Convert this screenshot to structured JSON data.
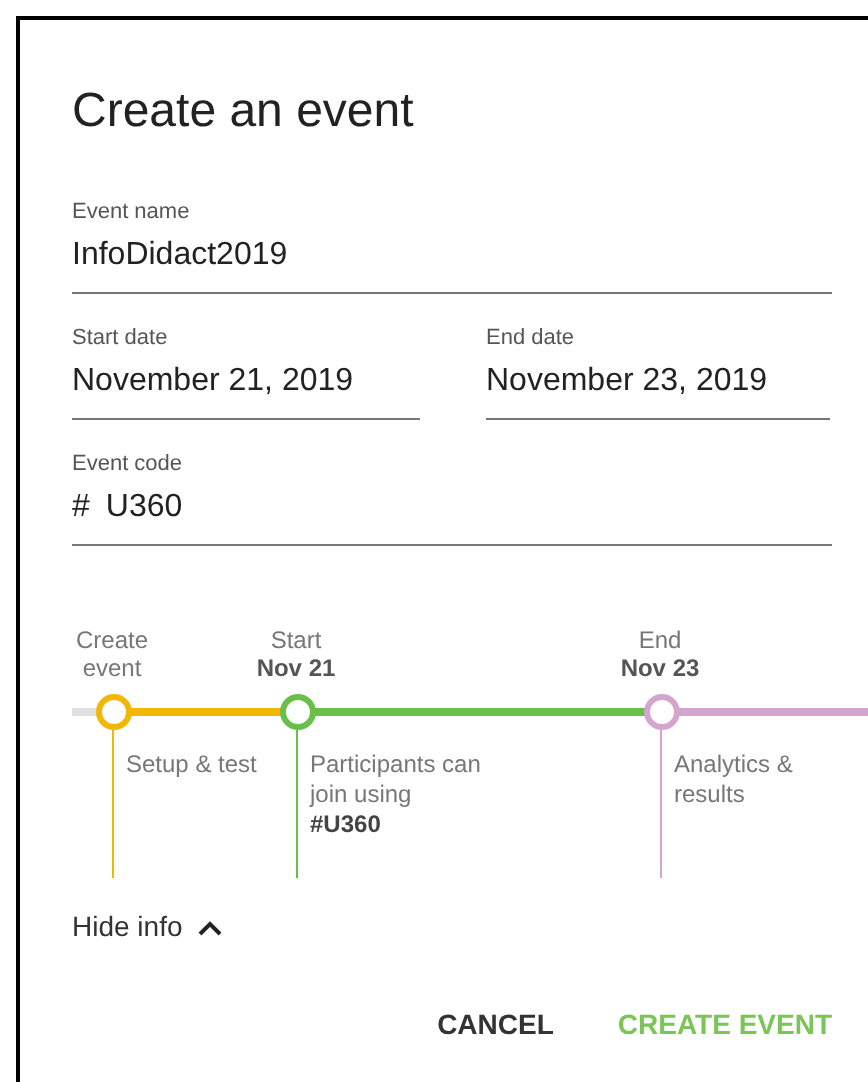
{
  "dialog": {
    "title": "Create an event",
    "fields": [
      {
        "label": "Event name",
        "value": "InfoDidact2019"
      },
      {
        "label": "Start date",
        "value": "November 21, 2019"
      },
      {
        "label": "End date",
        "value": "November 23, 2019"
      },
      {
        "label": "Event code",
        "prefix": "#",
        "value": "U360"
      }
    ],
    "timeline": [
      {
        "label": "Create event",
        "color": "#f2b705",
        "description": "Setup & test"
      },
      {
        "label": "Start",
        "date": "Nov 21",
        "color": "#6abf4b",
        "description": "Participants can join using **#U360**"
      },
      {
        "label": "End",
        "date": "Nov 23",
        "color": "#d4a5cf",
        "description": "Analytics & results"
      }
    ],
    "info_toggle": {
      "label": "Hide info",
      "expanded": true
    },
    "buttons": [
      {
        "label": "CANCEL",
        "kind": "secondary"
      },
      {
        "label": "CREATE EVENT",
        "kind": "primary"
      }
    ]
  }
}
